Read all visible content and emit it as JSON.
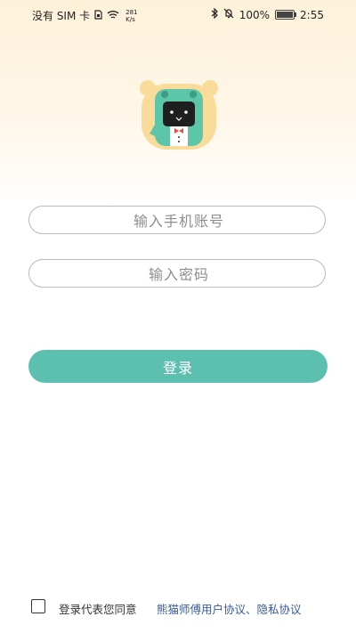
{
  "status_bar": {
    "carrier": "没有 SIM 卡",
    "net_speed_value": "281",
    "net_speed_unit": "K/s",
    "battery_percent": "100%",
    "time": "2:55"
  },
  "login": {
    "phone_placeholder": "输入手机账号",
    "password_placeholder": "输入密码",
    "login_label": "登录"
  },
  "agreement": {
    "prefix": "登录代表您同意",
    "links": "熊猫师傅用户协议、隐私协议"
  },
  "colors": {
    "accent": "#5dbfb0",
    "link": "#3a5a9c",
    "logo_bear": "#f9dc9a",
    "logo_costume": "#5ec6a8"
  },
  "icons": {
    "status": [
      "sim-icon",
      "wifi-icon",
      "bluetooth-icon",
      "mute-icon",
      "battery-icon"
    ],
    "logo": "panda-mascot-logo"
  }
}
